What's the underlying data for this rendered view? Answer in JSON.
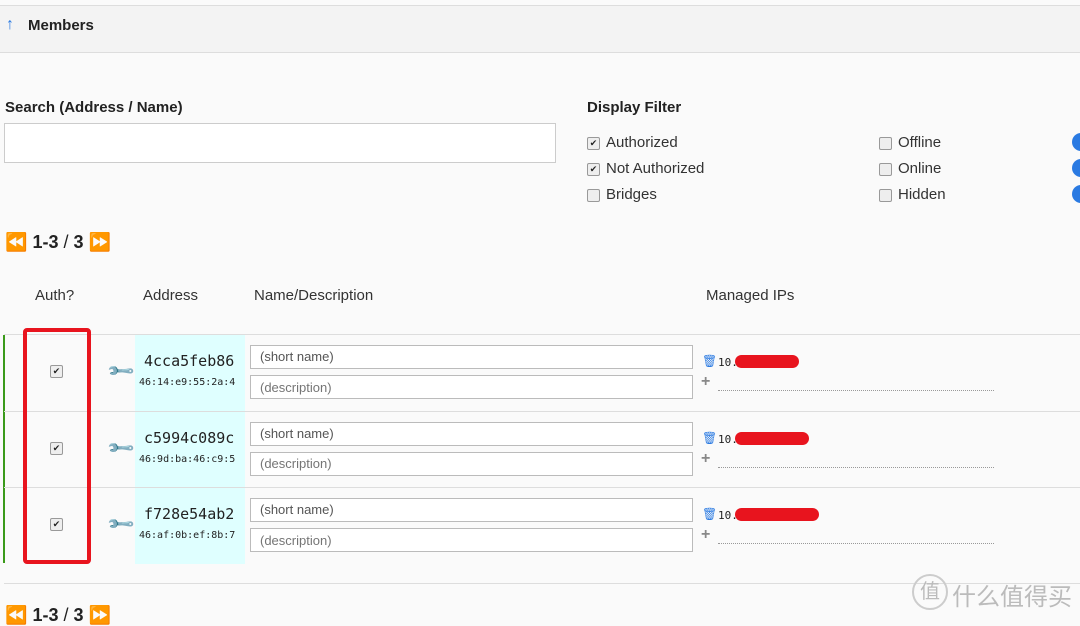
{
  "header": {
    "title": "Members",
    "icon": "arrow-up-icon"
  },
  "search": {
    "label": "Search (Address / Name)",
    "value": ""
  },
  "filter": {
    "label": "Display Filter",
    "options": [
      {
        "label": "Authorized",
        "checked": true
      },
      {
        "label": "Not Authorized",
        "checked": true
      },
      {
        "label": "Bridges",
        "checked": false
      },
      {
        "label": "Offline",
        "checked": false
      },
      {
        "label": "Online",
        "checked": false
      },
      {
        "label": "Hidden",
        "checked": false
      }
    ]
  },
  "pager": {
    "range": "1-3",
    "sep": "/",
    "total": "3"
  },
  "columns": {
    "auth": "Auth?",
    "address": "Address",
    "name": "Name/Description",
    "ips": "Managed IPs"
  },
  "members": [
    {
      "id": "4cca5feb86",
      "mac": "46:14:e9:55:2a:4",
      "name_placeholder": "(short name)",
      "desc_placeholder": "(description)",
      "ip": "10.",
      "authorized": true
    },
    {
      "id": "c5994c089c",
      "mac": "46:9d:ba:46:c9:5",
      "name_placeholder": "(short name)",
      "desc_placeholder": "(description)",
      "ip": "10.",
      "authorized": true
    },
    {
      "id": "f728e54ab2",
      "mac": "46:af:0b:ef:8b:7",
      "name_placeholder": "(short name)",
      "desc_placeholder": "(description)",
      "ip": "10.",
      "authorized": true
    }
  ],
  "watermark": {
    "badge": "值",
    "text": "什么值得买"
  },
  "colors": {
    "accent": "#2a7ae2",
    "highlight": "#e8141e",
    "address_bg": "#dfffff"
  }
}
